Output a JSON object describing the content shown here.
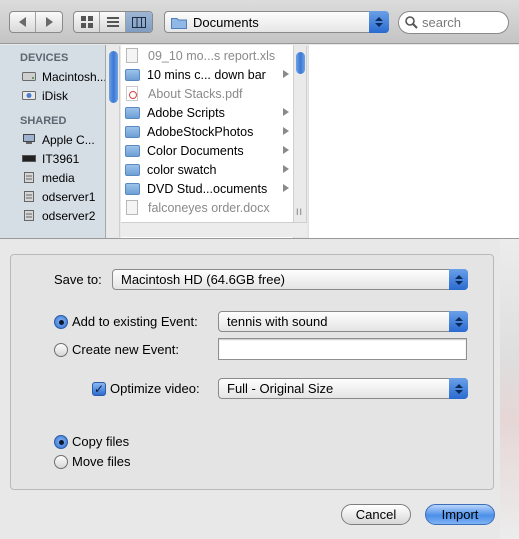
{
  "toolbar": {
    "back_icon": "back-arrow-icon",
    "forward_icon": "forward-arrow-icon",
    "view_modes": [
      "icon-view-icon",
      "list-view-icon",
      "column-view-icon"
    ],
    "active_view": "column-view-icon",
    "location": "Documents",
    "search_placeholder": "search"
  },
  "sidebar": {
    "devices_header": "DEVICES",
    "devices": [
      {
        "label": "Macintosh...",
        "icon": "hard-drive-icon"
      },
      {
        "label": "iDisk",
        "icon": "idisk-icon"
      }
    ],
    "shared_header": "SHARED",
    "shared": [
      {
        "label": "Apple C...",
        "icon": "computer-icon"
      },
      {
        "label": "IT3961",
        "icon": "display-icon"
      },
      {
        "label": "media",
        "icon": "server-icon"
      },
      {
        "label": "odserver1",
        "icon": "server-icon"
      },
      {
        "label": "odserver2",
        "icon": "server-icon"
      }
    ]
  },
  "files": [
    {
      "name": "09_10 mo...s report.xls",
      "kind": "document",
      "enabled": false,
      "has_children": false
    },
    {
      "name": "10 mins c... down bar",
      "kind": "folder",
      "enabled": true,
      "has_children": true
    },
    {
      "name": "About Stacks.pdf",
      "kind": "pdf",
      "enabled": false,
      "has_children": false
    },
    {
      "name": "Adobe Scripts",
      "kind": "folder",
      "enabled": true,
      "has_children": true
    },
    {
      "name": "AdobeStockPhotos",
      "kind": "folder",
      "enabled": true,
      "has_children": true
    },
    {
      "name": "Color Documents",
      "kind": "folder",
      "enabled": true,
      "has_children": true
    },
    {
      "name": "color swatch",
      "kind": "folder",
      "enabled": true,
      "has_children": true
    },
    {
      "name": "DVD Stud...ocuments",
      "kind": "folder",
      "enabled": true,
      "has_children": true
    },
    {
      "name": "falconeyes order.docx",
      "kind": "document",
      "enabled": false,
      "has_children": false
    }
  ],
  "options": {
    "save_to_label": "Save to:",
    "save_to_value": "Macintosh HD (64.6GB free)",
    "add_existing_label": "Add to existing Event:",
    "add_existing_selected": true,
    "existing_event_value": "tennis with sound",
    "create_new_label": "Create new Event:",
    "create_new_selected": false,
    "new_event_value": "",
    "optimize_label": "Optimize video:",
    "optimize_checked": true,
    "optimize_value": "Full - Original Size",
    "copy_files_label": "Copy files",
    "copy_files_selected": true,
    "move_files_label": "Move files",
    "move_files_selected": false
  },
  "buttons": {
    "cancel": "Cancel",
    "import": "Import"
  },
  "colors": {
    "accent": "#3b77d6",
    "sidebar_bg": "#d5dde5"
  }
}
